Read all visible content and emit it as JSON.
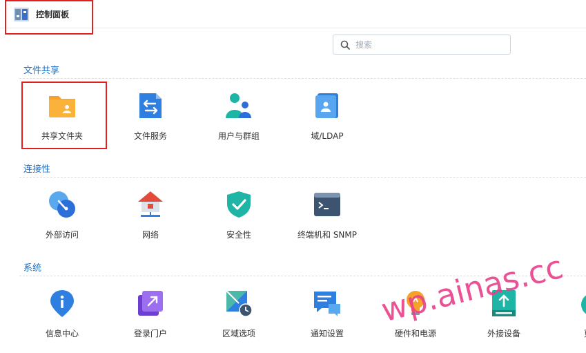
{
  "window": {
    "title": "控制面板",
    "icon": "control-panel-icon"
  },
  "search": {
    "placeholder": "搜索",
    "value": ""
  },
  "sections": [
    {
      "title": "文件共享",
      "items": [
        {
          "label": "共享文件夹",
          "icon": "shared-folder-icon"
        },
        {
          "label": "文件服务",
          "icon": "file-services-icon"
        },
        {
          "label": "用户与群组",
          "icon": "users-groups-icon"
        },
        {
          "label": "域/LDAP",
          "icon": "domain-ldap-icon"
        }
      ]
    },
    {
      "title": "连接性",
      "items": [
        {
          "label": "外部访问",
          "icon": "external-access-icon"
        },
        {
          "label": "网络",
          "icon": "network-icon"
        },
        {
          "label": "安全性",
          "icon": "security-icon"
        },
        {
          "label": "终端机和 SNMP",
          "icon": "terminal-snmp-icon"
        }
      ]
    },
    {
      "title": "系统",
      "items": [
        {
          "label": "信息中心",
          "icon": "info-center-icon"
        },
        {
          "label": "登录门户",
          "icon": "login-portal-icon"
        },
        {
          "label": "区域选项",
          "icon": "regional-options-icon"
        },
        {
          "label": "通知设置",
          "icon": "notification-icon"
        },
        {
          "label": "硬件和电源",
          "icon": "hardware-power-icon"
        },
        {
          "label": "外接设备",
          "icon": "external-devices-icon"
        },
        {
          "label": "更新",
          "icon": "update-icon"
        }
      ]
    }
  ],
  "watermark": "wp.ainas.cc",
  "colors": {
    "section_title": "#1d6fc4",
    "highlight": "#e02020",
    "watermark": "#e8408a"
  }
}
